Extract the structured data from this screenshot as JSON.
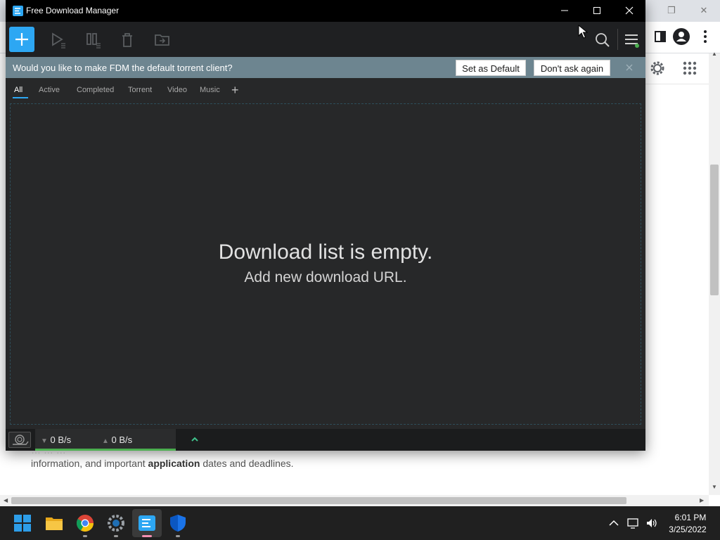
{
  "fdm": {
    "window_title": "Free Download Manager",
    "toolbar": {
      "add_icon": "plus-icon",
      "resume_icon": "play-icon",
      "pause_icon": "pause-icon",
      "delete_icon": "trash-icon",
      "move_icon": "folder-move-icon",
      "search_icon": "search-icon",
      "menu_icon": "hamburger-menu-icon"
    },
    "notice": {
      "text": "Would you like to make FDM the default torrent client?",
      "set_default_label": "Set as Default",
      "dont_ask_label": "Don't ask again"
    },
    "tabs": [
      {
        "label": "All",
        "active": true
      },
      {
        "label": "Active"
      },
      {
        "label": "Completed"
      },
      {
        "label": "Torrent"
      },
      {
        "label": "Video"
      },
      {
        "label": "Music"
      }
    ],
    "empty": {
      "title": "Download list is empty.",
      "subtitle": "Add new download URL."
    },
    "status": {
      "download_speed": "0 B/s",
      "upload_speed": "0 B/s"
    },
    "colors": {
      "accent": "#2da7f3",
      "notice_bg": "#6d8590",
      "window_bg": "#272829"
    }
  },
  "browser": {
    "page_text_line1": "… … …",
    "page_text_line2_a": "information, and important ",
    "page_text_line2_bold": "application",
    "page_text_line2_b": " dates and deadlines."
  },
  "taskbar": {
    "apps": [
      "start-icon",
      "file-explorer-icon",
      "chrome-icon",
      "settings-icon",
      "fdm-icon",
      "defender-icon"
    ],
    "time": "6:01 PM",
    "date": "3/25/2022"
  }
}
